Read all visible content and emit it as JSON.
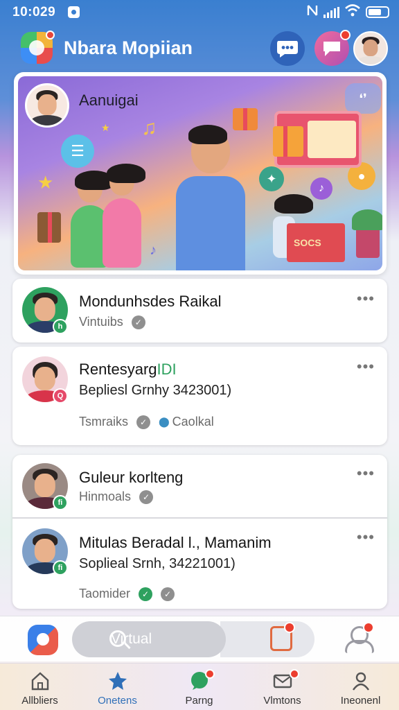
{
  "status_bar": {
    "time": "10:029"
  },
  "header": {
    "app_title": "Nbara Mopiian"
  },
  "hero": {
    "name": "Aanuigai",
    "stand_text": "SOCS"
  },
  "list_cards": [
    {
      "rows": [
        {
          "name": "Mondunhsdes Raikal",
          "meta_text": "Vintuibs",
          "badge": "h"
        }
      ]
    },
    {
      "rows": [
        {
          "name_main": "Rentesyarg",
          "name_accent": "IDI",
          "subtitle": "Bepliesl Grnhy 3423001)",
          "meta_text": "Tsmraiks",
          "location": "Caolkal",
          "badge": "Q"
        }
      ]
    },
    {
      "rows": [
        {
          "name": "Guleur korlteng",
          "meta_text": "Hinmoals",
          "badge": "fi"
        },
        {
          "name": "Mitulas Beradal l., Mamanim",
          "subtitle": "Soplieal Srnh, 34221001)",
          "meta_text": "Taomider",
          "badge": "fi"
        }
      ]
    }
  ],
  "quick_bar": {
    "search_label": "Virtual"
  },
  "tabs": [
    {
      "label": "Allbliers",
      "icon": "home-icon"
    },
    {
      "label": "Onetens",
      "icon": "star-icon",
      "active": true
    },
    {
      "label": "Parng",
      "icon": "chat-icon"
    },
    {
      "label": "Vlmtons",
      "icon": "mail-icon"
    },
    {
      "label": "Ineonenl",
      "icon": "profile-icon"
    }
  ],
  "colors": {
    "accent_blue": "#2f6fb8",
    "badge_red": "#ec3e2f",
    "online_green": "#2ea15f"
  }
}
